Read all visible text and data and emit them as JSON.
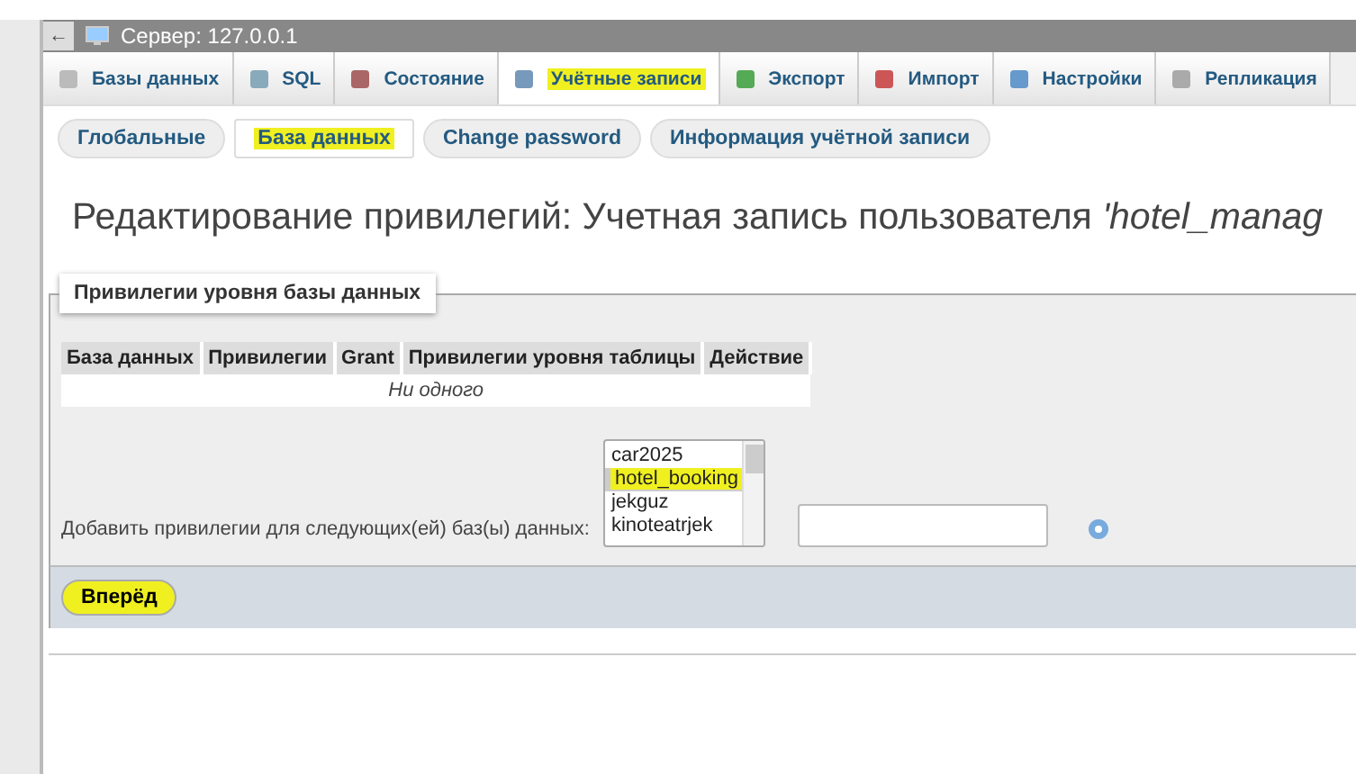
{
  "server_bar": {
    "back": "←",
    "title": "Сервер: 127.0.0.1"
  },
  "tabs": [
    {
      "label": "Базы данных",
      "selected": false,
      "highlighted": false
    },
    {
      "label": "SQL",
      "selected": false,
      "highlighted": false
    },
    {
      "label": "Состояние",
      "selected": false,
      "highlighted": false
    },
    {
      "label": "Учётные записи",
      "selected": true,
      "highlighted": true
    },
    {
      "label": "Экспорт",
      "selected": false,
      "highlighted": false
    },
    {
      "label": "Импорт",
      "selected": false,
      "highlighted": false
    },
    {
      "label": "Настройки",
      "selected": false,
      "highlighted": false
    },
    {
      "label": "Репликация",
      "selected": false,
      "highlighted": false
    }
  ],
  "subtabs": [
    {
      "label": "Глобальные",
      "selected": false,
      "highlighted": false
    },
    {
      "label": "База данных",
      "selected": true,
      "highlighted": true
    },
    {
      "label": "Change password",
      "selected": false,
      "highlighted": false
    },
    {
      "label": "Информация учётной записи",
      "selected": false,
      "highlighted": false
    }
  ],
  "heading": "Редактирование привилегий: Учетная запись пользователя *'hotel_manag*",
  "fieldset": {
    "legend": "Привилегии уровня базы данных",
    "table": {
      "columns": [
        "База данных",
        "Привилегии",
        "Grant",
        "Привилегии уровня таблицы",
        "Действие"
      ],
      "empty_text": "Ни одного"
    },
    "add_label": "Добавить привилегии для следующих(ей) баз(ы) данных:",
    "databases": [
      {
        "name": "car2025",
        "selected": false,
        "highlighted": false
      },
      {
        "name": "hotel_booking",
        "selected": true,
        "highlighted": true
      },
      {
        "name": "jekguz",
        "selected": false,
        "highlighted": false
      },
      {
        "name": "kinoteatrjek",
        "selected": false,
        "highlighted": false
      }
    ]
  },
  "submit": {
    "label": "Вперёд",
    "highlighted": true
  }
}
